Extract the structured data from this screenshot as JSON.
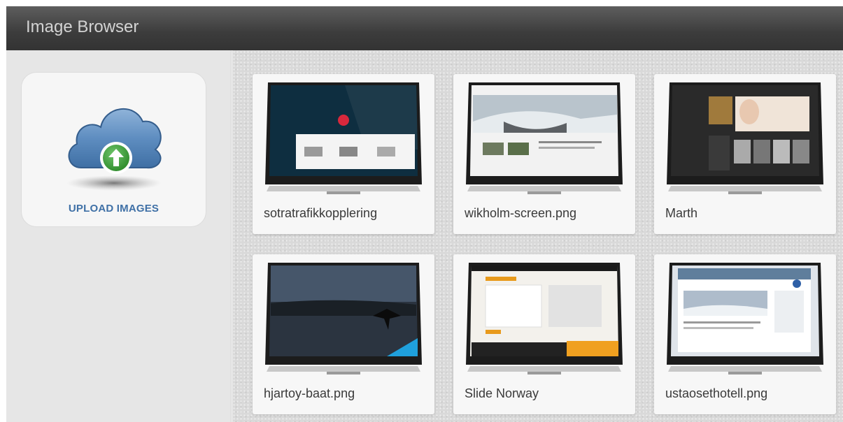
{
  "header": {
    "title": "Image Browser"
  },
  "sidebar": {
    "upload_label": "UPLOAD IMAGES"
  },
  "images": [
    {
      "name": "sotratrafikkopplering"
    },
    {
      "name": "wikholm-screen.png"
    },
    {
      "name": "Marth"
    },
    {
      "name": "hjartoy-baat.png"
    },
    {
      "name": "Slide Norway"
    },
    {
      "name": "ustaosethotell.png"
    }
  ],
  "icons": {
    "upload": "cloud-upload-icon"
  },
  "colors": {
    "header": "#444444",
    "upload_text": "#3f70a6",
    "upload_arrow": "#3c9a3a"
  }
}
